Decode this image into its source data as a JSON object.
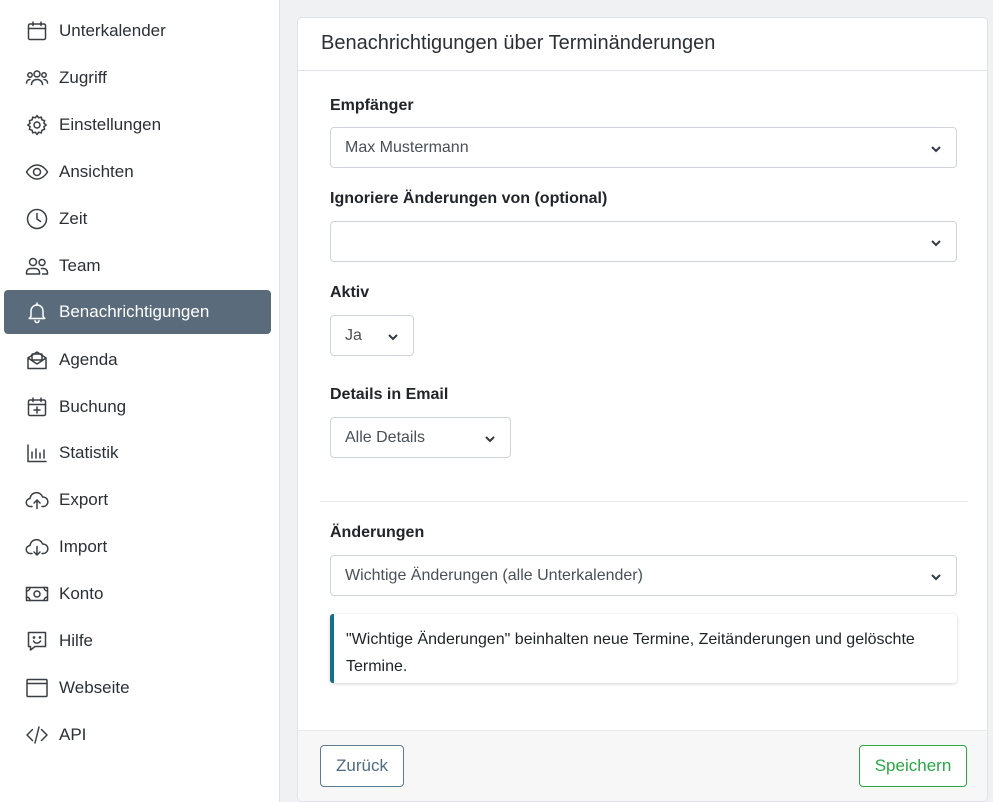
{
  "sidebar": {
    "items": [
      {
        "label": "Unterkalender",
        "icon": "calendar-icon"
      },
      {
        "label": "Zugriff",
        "icon": "users-icon"
      },
      {
        "label": "Einstellungen",
        "icon": "gear-icon"
      },
      {
        "label": "Ansichten",
        "icon": "eye-icon"
      },
      {
        "label": "Zeit",
        "icon": "clock-icon"
      },
      {
        "label": "Team",
        "icon": "team-icon"
      },
      {
        "label": "Benachrichtigungen",
        "icon": "bell-icon",
        "active": true
      },
      {
        "label": "Agenda",
        "icon": "envelope-icon"
      },
      {
        "label": "Buchung",
        "icon": "calendar-plus-icon"
      },
      {
        "label": "Statistik",
        "icon": "bar-chart-icon"
      },
      {
        "label": "Export",
        "icon": "cloud-upload-icon"
      },
      {
        "label": "Import",
        "icon": "cloud-download-icon"
      },
      {
        "label": "Konto",
        "icon": "cash-icon"
      },
      {
        "label": "Hilfe",
        "icon": "chat-smile-icon"
      },
      {
        "label": "Webseite",
        "icon": "window-icon"
      },
      {
        "label": "API",
        "icon": "code-icon"
      }
    ],
    "active_color": "#5a6b7b"
  },
  "card": {
    "title": "Benachrichtigungen über Terminänderungen"
  },
  "form": {
    "recipient": {
      "label": "Empfänger",
      "value": "Max Mustermann"
    },
    "ignore": {
      "label": "Ignoriere Änderungen von (optional)",
      "value": ""
    },
    "active": {
      "label": "Aktiv",
      "value": "Ja"
    },
    "details": {
      "label": "Details in Email",
      "value": "Alle Details"
    },
    "changes": {
      "label": "Änderungen",
      "value": "Wichtige Änderungen (alle Unterkalender)"
    },
    "info": "\"Wichtige Änderungen\" beinhalten neue Termine, Zeitänderungen und gelöschte Termine."
  },
  "footer": {
    "back_label": "Zurück",
    "save_label": "Speichern"
  },
  "colors": {
    "save": "#28a745",
    "back": "#4f6c82",
    "info_border": "#17708a"
  }
}
